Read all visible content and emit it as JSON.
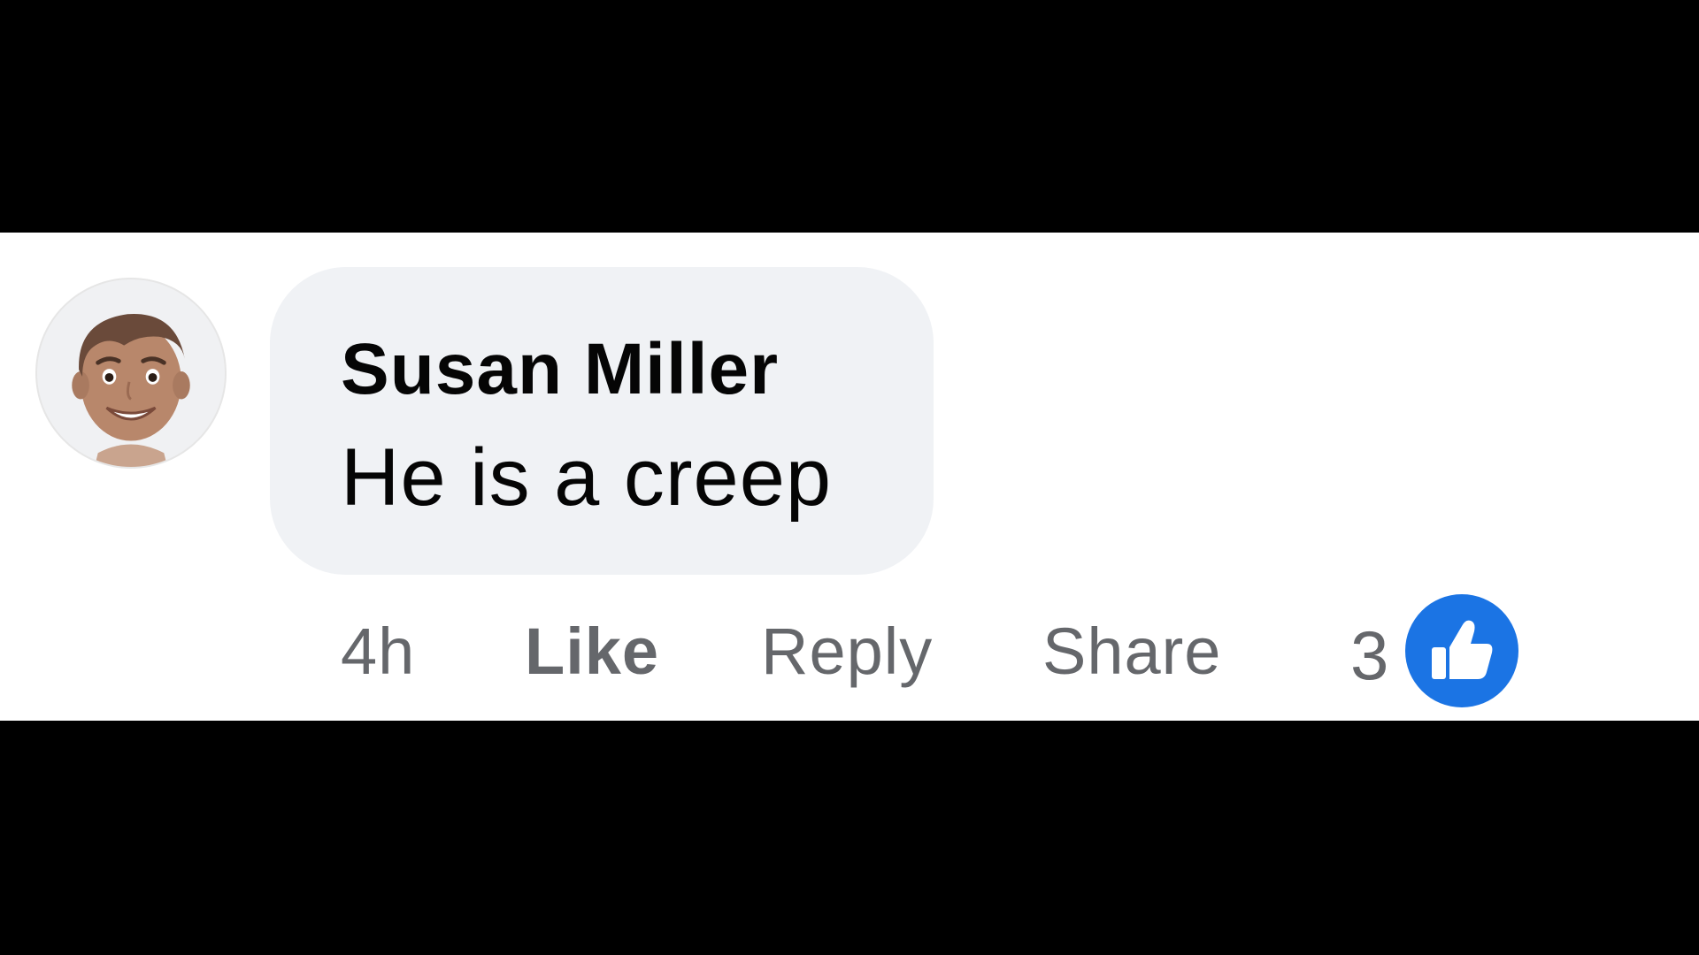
{
  "comment": {
    "author": "Susan Miller",
    "text": "He is a creep",
    "timestamp": "4h",
    "actions": {
      "like": "Like",
      "reply": "Reply",
      "share": "Share"
    },
    "reactions": {
      "count": "3",
      "icon": "thumbs-up-icon",
      "color": "#1b74e4"
    },
    "avatar": {
      "icon": "memoji-avatar"
    }
  },
  "colors": {
    "bubble": "#f0f2f5",
    "primary_text": "#050505",
    "secondary_text": "#65676b",
    "accent": "#1b74e4"
  }
}
